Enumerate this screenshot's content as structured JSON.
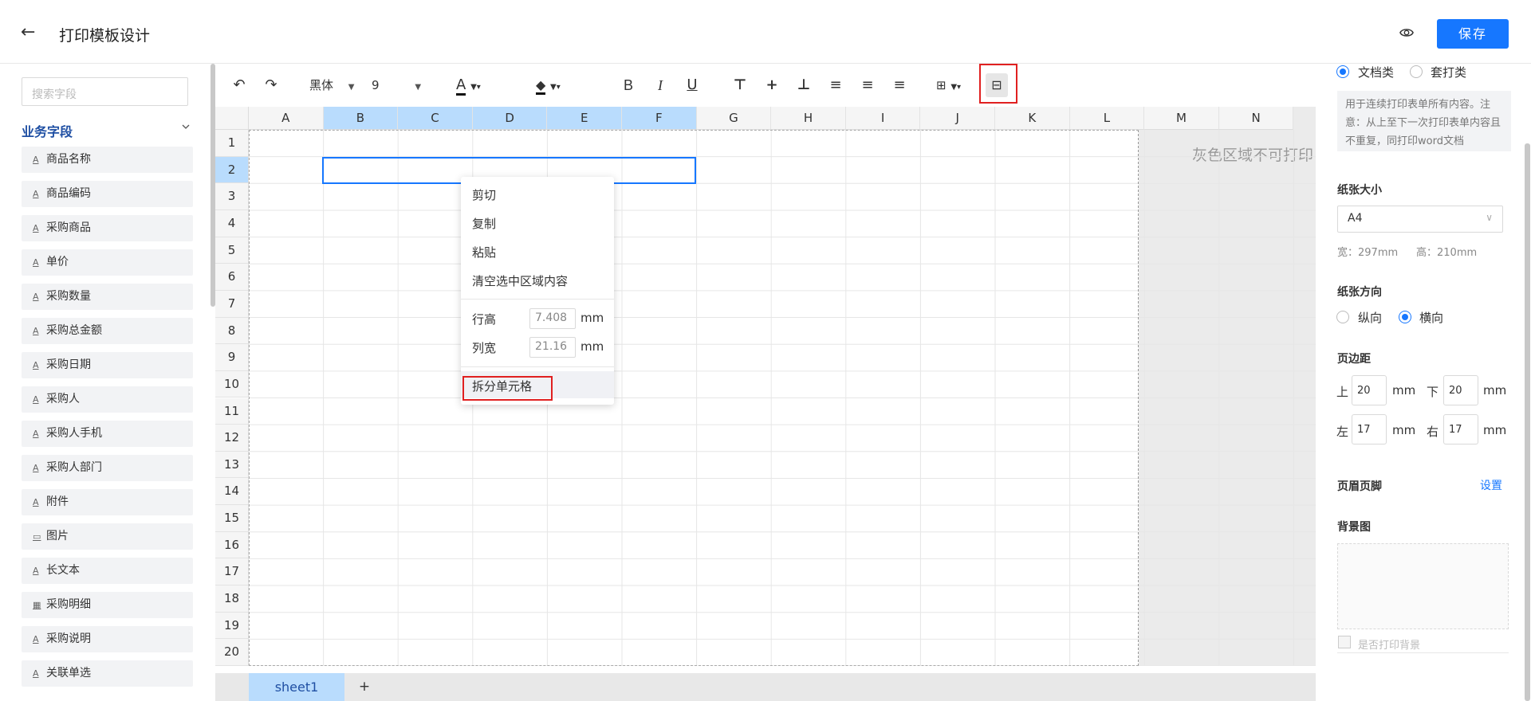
{
  "header": {
    "back_icon": "arrow-left-icon",
    "title": "打印模板设计",
    "preview_icon": "eye-icon",
    "save_label": "保存",
    "accent_color": "#1677ff"
  },
  "left": {
    "search_placeholder": "搜索字段",
    "group_title": "业务字段",
    "fields": [
      {
        "icon": "A",
        "label": "商品名称"
      },
      {
        "icon": "A",
        "label": "商品编码"
      },
      {
        "icon": "A",
        "label": "采购商品"
      },
      {
        "icon": "A",
        "label": "单价"
      },
      {
        "icon": "A",
        "label": "采购数量"
      },
      {
        "icon": "A",
        "label": "采购总金额"
      },
      {
        "icon": "A",
        "label": "采购日期"
      },
      {
        "icon": "A",
        "label": "采购人"
      },
      {
        "icon": "A",
        "label": "采购人手机"
      },
      {
        "icon": "A",
        "label": "采购人部门"
      },
      {
        "icon": "A",
        "label": "附件"
      },
      {
        "icon": "▭",
        "label": "图片"
      },
      {
        "icon": "A",
        "label": "长文本"
      },
      {
        "icon": "▦",
        "label": "采购明细"
      },
      {
        "icon": "A",
        "label": "采购说明"
      },
      {
        "icon": "A",
        "label": "关联单选"
      }
    ]
  },
  "toolbar": {
    "font_family": "黑体",
    "font_size": "9",
    "text_color_glyph": "A",
    "bold": "B",
    "italic": "I",
    "underline": "U"
  },
  "sheet": {
    "columns": [
      "A",
      "B",
      "C",
      "D",
      "E",
      "F",
      "G",
      "H",
      "I",
      "J",
      "K",
      "L",
      "M",
      "N"
    ],
    "rows": [
      "1",
      "2",
      "3",
      "4",
      "5",
      "6",
      "7",
      "8",
      "9",
      "10",
      "11",
      "12",
      "13",
      "14",
      "15",
      "16",
      "17",
      "18",
      "19",
      "20"
    ],
    "gray_area_text": "灰色区域不可打印",
    "tab_name": "sheet1",
    "add_tab": "+"
  },
  "context_menu": {
    "cut": "剪切",
    "copy": "复制",
    "paste": "粘贴",
    "clear": "清空选中区域内容",
    "row_height_label": "行高",
    "row_height_value": "7.408",
    "col_width_label": "列宽",
    "col_width_value": "21.16",
    "unit": "mm",
    "split": "拆分单元格"
  },
  "right": {
    "type_doc": "文档类",
    "type_overlay": "套打类",
    "type_desc": "用于连续打印表单所有内容。注意：从上至下一次打印表单内容且不重复，同打印word文档",
    "paper_size_label": "纸张大小",
    "paper_size_value": "A4",
    "paper_width": "宽：297mm",
    "paper_height": "高：210mm",
    "orientation_label": "纸张方向",
    "portrait": "纵向",
    "landscape": "横向",
    "margin_label": "页边距",
    "margin_top_label": "上",
    "margin_top": "20",
    "margin_bottom_label": "下",
    "margin_bottom": "20",
    "margin_left_label": "左",
    "margin_left": "17",
    "margin_right_label": "右",
    "margin_right": "17",
    "mm": "mm",
    "header_footer_label": "页眉页脚",
    "header_footer_link": "设置",
    "bg_label": "背景图",
    "print_bg_label": "是否打印背景"
  }
}
